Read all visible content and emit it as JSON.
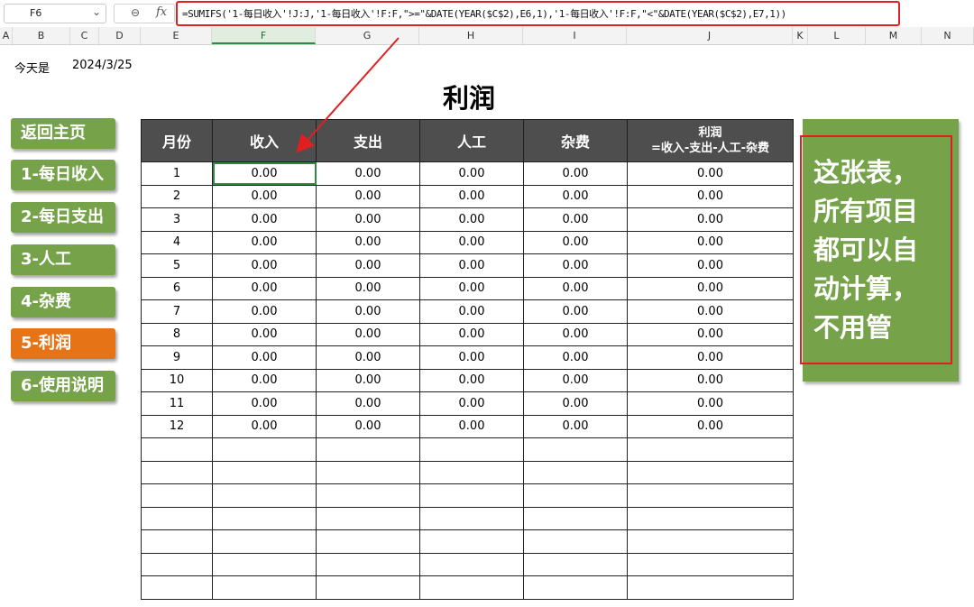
{
  "formula_bar": {
    "name_box": "F6",
    "formula": "=SUMIFS('1-每日收入'!J:J,'1-每日收入'!F:F,\">=\"&DATE(YEAR($C$2),E6,1),'1-每日收入'!F:F,\"<\"&DATE(YEAR($C$2),E7,1))",
    "icons": [
      "chevron-down-icon",
      "zoom-icon",
      "fx-icon"
    ]
  },
  "columns": [
    "A",
    "B",
    "C",
    "D",
    "E",
    "F",
    "G",
    "H",
    "I",
    "J",
    "K",
    "L",
    "M",
    "N"
  ],
  "active_column": "F",
  "today": {
    "label": "今天是",
    "value": "2024/3/25"
  },
  "title": "利润",
  "nav": [
    {
      "label": "返回主页",
      "active": false
    },
    {
      "label": "1-每日收入",
      "active": false
    },
    {
      "label": "2-每日支出",
      "active": false
    },
    {
      "label": "3-人工",
      "active": false
    },
    {
      "label": "4-杂费",
      "active": false
    },
    {
      "label": "5-利润",
      "active": true
    },
    {
      "label": "6-使用说明",
      "active": false
    }
  ],
  "table": {
    "headers": {
      "month": "月份",
      "income": "收入",
      "expense": "支出",
      "labor": "人工",
      "misc": "杂费",
      "profit_line1": "利润",
      "profit_line2": "=收入-支出-人工-杂费"
    },
    "rows": [
      [
        "1",
        "0.00",
        "0.00",
        "0.00",
        "0.00",
        "0.00"
      ],
      [
        "2",
        "0.00",
        "0.00",
        "0.00",
        "0.00",
        "0.00"
      ],
      [
        "3",
        "0.00",
        "0.00",
        "0.00",
        "0.00",
        "0.00"
      ],
      [
        "4",
        "0.00",
        "0.00",
        "0.00",
        "0.00",
        "0.00"
      ],
      [
        "5",
        "0.00",
        "0.00",
        "0.00",
        "0.00",
        "0.00"
      ],
      [
        "6",
        "0.00",
        "0.00",
        "0.00",
        "0.00",
        "0.00"
      ],
      [
        "7",
        "0.00",
        "0.00",
        "0.00",
        "0.00",
        "0.00"
      ],
      [
        "8",
        "0.00",
        "0.00",
        "0.00",
        "0.00",
        "0.00"
      ],
      [
        "9",
        "0.00",
        "0.00",
        "0.00",
        "0.00",
        "0.00"
      ],
      [
        "10",
        "0.00",
        "0.00",
        "0.00",
        "0.00",
        "0.00"
      ],
      [
        "11",
        "0.00",
        "0.00",
        "0.00",
        "0.00",
        "0.00"
      ],
      [
        "12",
        "0.00",
        "0.00",
        "0.00",
        "0.00",
        "0.00"
      ]
    ],
    "empty_rows": 7
  },
  "note": {
    "lines": [
      "这张表，",
      "所有项目",
      "都可以自",
      "动计算，",
      "不用管"
    ]
  },
  "colors": {
    "green": "#76a34a",
    "orange": "#e67316",
    "header_gray": "#4e4e4e",
    "highlight_red": "#e02020"
  }
}
